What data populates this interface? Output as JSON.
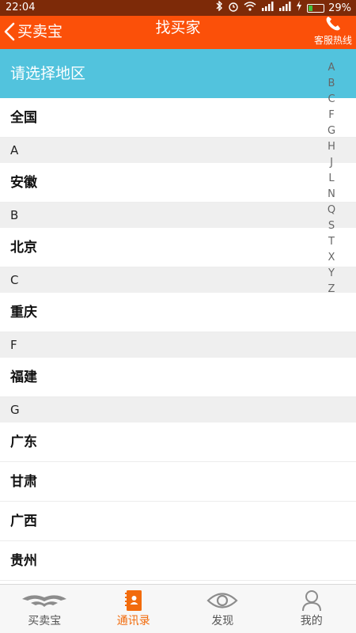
{
  "status_bar": {
    "time": "22:04",
    "battery_percent": 29,
    "battery_text": "29%"
  },
  "header": {
    "back_label": "买卖宝",
    "title": "找买家",
    "hotline_label": "客服热线"
  },
  "region_prompt": "请选择地区",
  "list": [
    {
      "kind": "item",
      "text": "全国"
    },
    {
      "kind": "header",
      "text": "A"
    },
    {
      "kind": "item",
      "text": "安徽"
    },
    {
      "kind": "header",
      "text": "B"
    },
    {
      "kind": "item",
      "text": "北京"
    },
    {
      "kind": "header",
      "text": "C"
    },
    {
      "kind": "item",
      "text": "重庆"
    },
    {
      "kind": "header",
      "text": "F"
    },
    {
      "kind": "item",
      "text": "福建"
    },
    {
      "kind": "header",
      "text": "G"
    },
    {
      "kind": "item",
      "text": "广东"
    },
    {
      "kind": "item",
      "text": "甘肃"
    },
    {
      "kind": "item",
      "text": "广西"
    },
    {
      "kind": "item",
      "text": "贵州"
    }
  ],
  "alphabet": [
    "A",
    "B",
    "C",
    "F",
    "G",
    "H",
    "J",
    "L",
    "N",
    "Q",
    "S",
    "T",
    "X",
    "Y",
    "Z"
  ],
  "tabs": [
    {
      "label": "买卖宝",
      "icon": "logo-icon",
      "active": false
    },
    {
      "label": "通讯录",
      "icon": "contacts-icon",
      "active": true
    },
    {
      "label": "发现",
      "icon": "eye-icon",
      "active": false
    },
    {
      "label": "我的",
      "icon": "user-icon",
      "active": false
    }
  ],
  "colors": {
    "header": "#fb5009",
    "region_bar": "#52c3dd",
    "active_tab": "#f26b0c",
    "status_bar": "#7d2a08"
  }
}
